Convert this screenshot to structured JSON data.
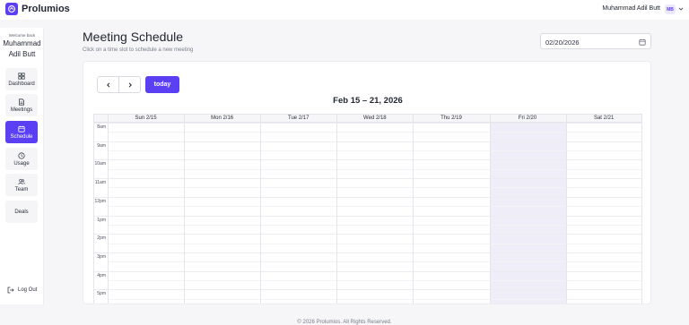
{
  "app": {
    "brand": "Prolumios"
  },
  "user": {
    "name": "Muhammad Adil Butt",
    "initials": "MB"
  },
  "sidebar": {
    "welcome": "Welcome back",
    "name": "Muhammad Adil Butt",
    "items": [
      {
        "label": "Dashboard",
        "icon": "dashboard-icon"
      },
      {
        "label": "Meetings",
        "icon": "document-icon"
      },
      {
        "label": "Schedule",
        "icon": "calendar-icon",
        "active": true
      },
      {
        "label": "Usage",
        "icon": "clock-icon"
      },
      {
        "label": "Team",
        "icon": "users-icon"
      },
      {
        "label": "Deals",
        "icon": ""
      }
    ],
    "logout": "Log Out"
  },
  "page": {
    "title": "Meeting Schedule",
    "subtitle": "Click on a time slot to schedule a new meeting"
  },
  "date_picker": {
    "value": "02/20/2026"
  },
  "calendar": {
    "range_title": "Feb 15 – 21, 2026",
    "today_label": "today",
    "days": [
      "Sun 2/15",
      "Mon 2/16",
      "Tue 2/17",
      "Wed 2/18",
      "Thu 2/19",
      "Fri 2/20",
      "Sat 2/21"
    ],
    "today_index": 5,
    "times": [
      "8am",
      "9am",
      "10am",
      "11am",
      "12pm",
      "1pm",
      "2pm",
      "3pm",
      "4pm",
      "5pm"
    ]
  },
  "footer": {
    "text": "© 2026 Prolumios. All Rights Reserved."
  },
  "colors": {
    "accent": "#5b3ff2",
    "today_column": "#efeef8"
  }
}
